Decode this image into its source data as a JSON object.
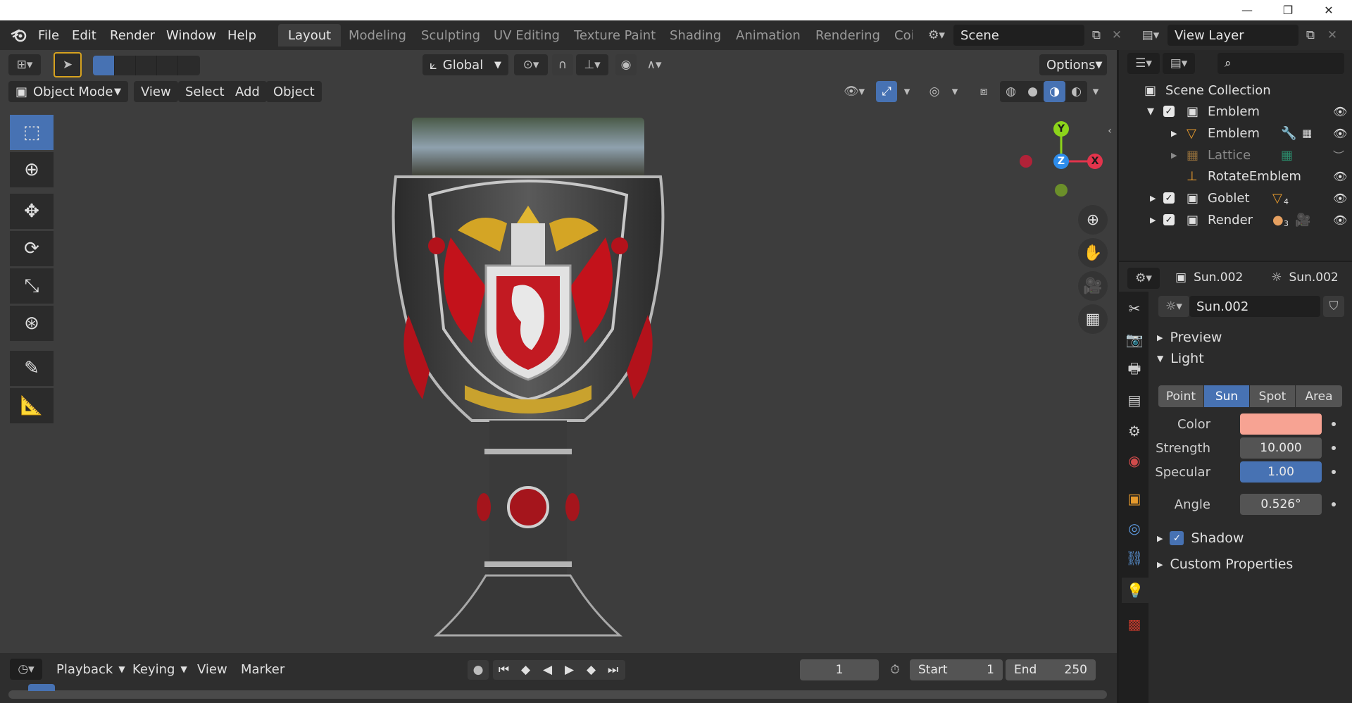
{
  "window": {
    "minimize": "—",
    "maximize": "❐",
    "close": "✕"
  },
  "menubar": {
    "file": "File",
    "edit": "Edit",
    "render": "Render",
    "window": "Window",
    "help": "Help"
  },
  "workspaces": [
    "Layout",
    "Modeling",
    "Sculpting",
    "UV Editing",
    "Texture Paint",
    "Shading",
    "Animation",
    "Rendering",
    "Coi"
  ],
  "scene": {
    "name": "Scene"
  },
  "view_layer": {
    "name": "View Layer"
  },
  "toolbar": {
    "orientation": "Global",
    "options": "Options"
  },
  "viewport_header": {
    "mode": "Object Mode",
    "view": "View",
    "select": "Select",
    "add": "Add",
    "object": "Object"
  },
  "gizmo": {
    "y": "Y",
    "z": "Z",
    "x": "X"
  },
  "colors": {
    "accent": "#4772b3",
    "axis_x": "#e3344c",
    "axis_y": "#8cd41a",
    "axis_z": "#2d8ceb",
    "light_color": "#f7a393"
  },
  "outliner": {
    "root": "Scene Collection",
    "rows": [
      {
        "label": "Emblem"
      },
      {
        "label": "Emblem"
      },
      {
        "label": "Lattice"
      },
      {
        "label": "RotateEmblem"
      },
      {
        "label": "Goblet",
        "badge": "4"
      },
      {
        "label": "Render",
        "badge": "3"
      }
    ]
  },
  "properties": {
    "header_object": "Sun.002",
    "header_data": "Sun.002",
    "datablock": "Sun.002",
    "panels": {
      "preview": "Preview",
      "light": "Light",
      "shadow": "Shadow",
      "custom": "Custom Properties"
    },
    "light_types": [
      "Point",
      "Sun",
      "Spot",
      "Area"
    ],
    "selected_type": "Sun",
    "fields": {
      "color_label": "Color",
      "strength_label": "Strength",
      "strength": "10.000",
      "specular_label": "Specular",
      "specular": "1.00",
      "angle_label": "Angle",
      "angle": "0.526°"
    }
  },
  "timeline": {
    "playback": "Playback",
    "keying": "Keying",
    "view": "View",
    "marker": "Marker",
    "current_frame": "1",
    "start_label": "Start",
    "start": "1",
    "end_label": "End",
    "end": "250"
  }
}
